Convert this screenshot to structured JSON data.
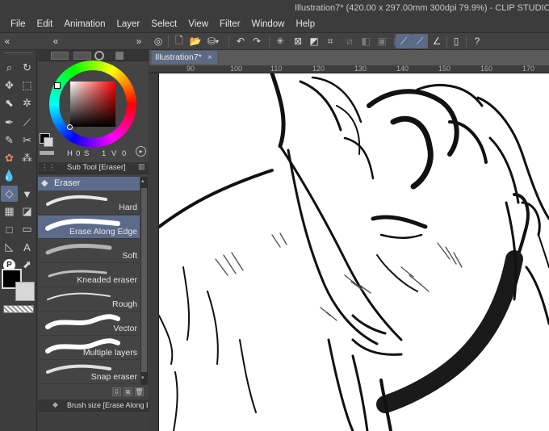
{
  "window": {
    "title": "Illustration7* (420.00 x 297.00mm 300dpi 79.9%) - CLIP STUDIO PAINT P"
  },
  "menu": [
    "File",
    "Edit",
    "Animation",
    "Layer",
    "Select",
    "View",
    "Filter",
    "Window",
    "Help"
  ],
  "document_tab": {
    "label": "Illustration7*",
    "close": "×"
  },
  "ruler_top": [
    "90",
    "100",
    "110",
    "120",
    "130",
    "140",
    "150",
    "160",
    "170"
  ],
  "color_panel": {
    "hsv_labels": [
      "H",
      "S",
      "V"
    ],
    "hsv_values": [
      "0",
      "1",
      "0"
    ]
  },
  "subtool_panel": {
    "header": "Sub Tool [Eraser]",
    "group": "Eraser",
    "brushes": [
      {
        "label": "Hard",
        "selected": false
      },
      {
        "label": "Erase Along Edge",
        "selected": true
      },
      {
        "label": "Soft",
        "selected": false
      },
      {
        "label": "Kneaded eraser",
        "selected": false
      },
      {
        "label": "Rough",
        "selected": false
      },
      {
        "label": "Vector",
        "selected": false
      },
      {
        "label": "Multiple layers",
        "selected": false
      },
      {
        "label": "Snap eraser",
        "selected": false
      }
    ]
  },
  "brush_size_panel": {
    "header": "Brush size [Erase Along Edg"
  },
  "colors": {
    "accent": "#5d6b8b",
    "main_color": "#000000",
    "sub_color": "#d8d8d8"
  }
}
